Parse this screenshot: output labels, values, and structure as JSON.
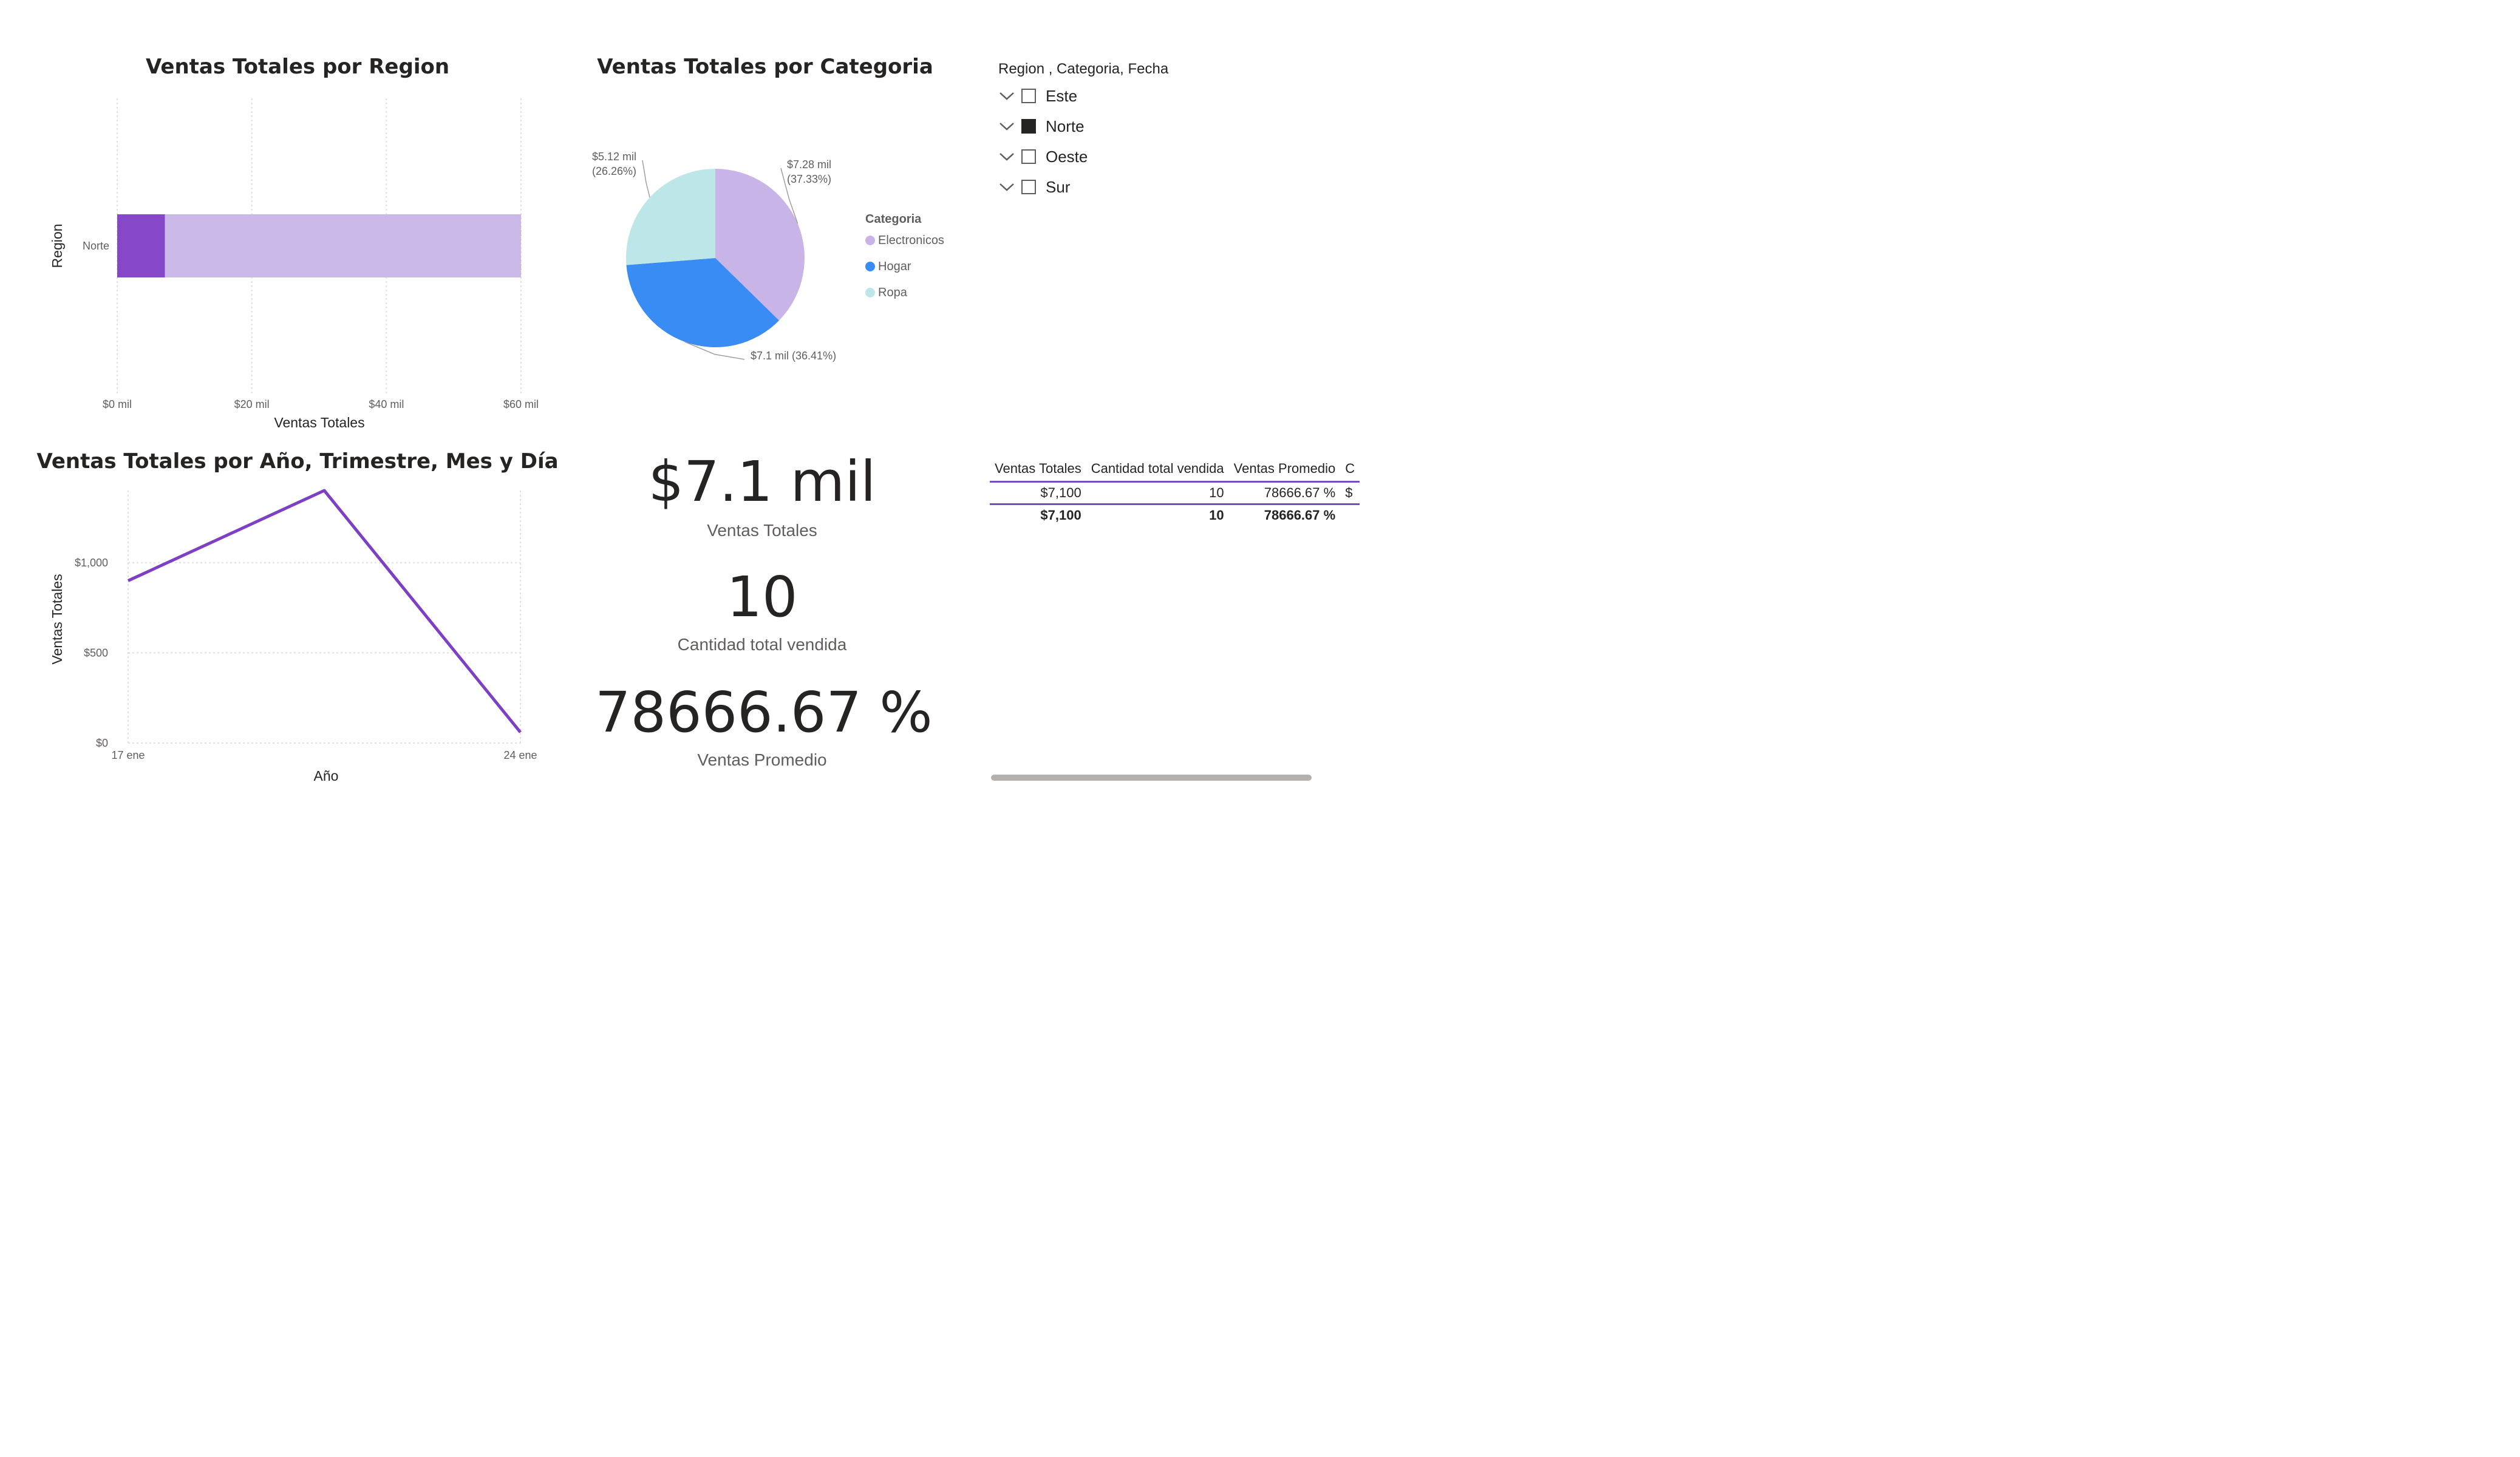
{
  "region_chart": {
    "title": "Ventas Totales por Region",
    "chart_data": {
      "type": "bar",
      "orientation": "horizontal",
      "stacked": true,
      "categories": [
        "Norte"
      ],
      "series": [
        {
          "values": [
            7.1
          ],
          "color": "#8647c9"
        },
        {
          "values": [
            52.9
          ],
          "color": "#cab8e8"
        }
      ],
      "xlabel": "Ventas Totales",
      "ylabel": "Region",
      "xlim": [
        0,
        60
      ],
      "xticks": [
        "$0 mil",
        "$20 mil",
        "$40 mil",
        "$60 mil"
      ],
      "grid": true
    }
  },
  "category_chart": {
    "title": "Ventas Totales por Categoria",
    "chart_data": {
      "type": "pie",
      "legend_title": "Categoria",
      "legend_position": "right",
      "slices": [
        {
          "name": "Electronicos",
          "value": 7.28,
          "percent": 37.33,
          "label_line1": "$7.28 mil",
          "label_line2": "(37.33%)",
          "color": "#c8b4e6"
        },
        {
          "name": "Hogar",
          "value": 7.1,
          "percent": 36.41,
          "label_line1": "$7.1 mil (36.41%)",
          "label_line2": "",
          "color": "#3a8cf5"
        },
        {
          "name": "Ropa",
          "value": 5.12,
          "percent": 26.26,
          "label_line1": "$5.12 mil",
          "label_line2": "(26.26%)",
          "color": "#bde6e8"
        }
      ]
    }
  },
  "slicer": {
    "title": "Region , Categoria, Fecha",
    "items": [
      {
        "label": "Este",
        "checked": false
      },
      {
        "label": "Norte",
        "checked": true
      },
      {
        "label": "Oeste",
        "checked": false
      },
      {
        "label": "Sur",
        "checked": false
      }
    ]
  },
  "line_chart": {
    "title": "Ventas Totales por Año, Trimestre, Mes y Día",
    "chart_data": {
      "type": "line",
      "x": [
        "17 ene",
        "",
        "24 ene"
      ],
      "series": [
        {
          "values": [
            900,
            1400,
            60
          ],
          "color": "#7d3fc4"
        }
      ],
      "xlabel": "Año",
      "ylabel": "Ventas Totales",
      "ylim": [
        0,
        1400
      ],
      "yticks": [
        "$0",
        "$500",
        "$1,000"
      ],
      "grid": true
    }
  },
  "cards": [
    {
      "value": "$7.1 mil",
      "label": "Ventas Totales"
    },
    {
      "value": "10",
      "label": "Cantidad total vendida"
    },
    {
      "value": "78666.67 %",
      "label": "Ventas Promedio"
    }
  ],
  "table": {
    "headers": [
      "Ventas Totales",
      "Cantidad total vendida",
      "Ventas Promedio",
      "C"
    ],
    "rows": [
      [
        "$7,100",
        "10",
        "78666.67 %",
        "$"
      ]
    ],
    "total": [
      "$7,100",
      "10",
      "78666.67 %",
      ""
    ]
  },
  "colors": {
    "accent": "#744ec2",
    "bar_highlight": "#8647c9",
    "bar_base": "#cab8e8",
    "line": "#7d3fc4"
  }
}
